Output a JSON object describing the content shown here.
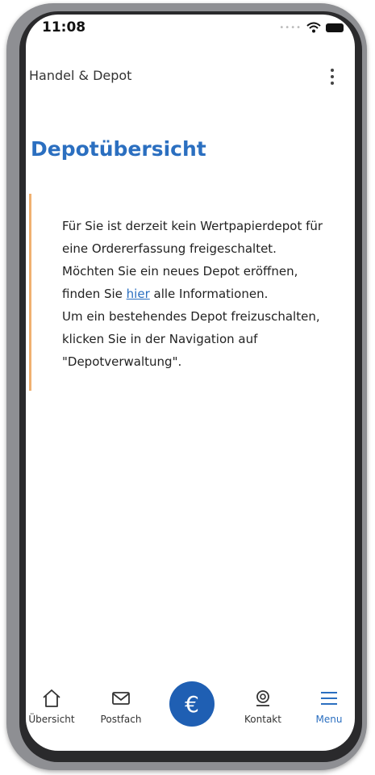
{
  "status_bar": {
    "time": "11:08"
  },
  "header": {
    "title": "Handel & Depot"
  },
  "page": {
    "title": "Depotübersicht"
  },
  "info": {
    "line1": "Für Sie ist derzeit kein Wertpapierdepot für eine Ordererfassung freigeschaltet. Möchten Sie ein neues Depot eröffnen, finden Sie ",
    "link": "hier",
    "line2": " alle Informationen.",
    "line3": "Um ein bestehendes Depot freizuschalten, klicken Sie in der Navigation auf \"Depotverwaltung\"."
  },
  "tabbar": {
    "items": [
      {
        "label": "Übersicht",
        "icon": "home-icon"
      },
      {
        "label": "Postfach",
        "icon": "mail-icon"
      },
      {
        "label": "€",
        "icon": "euro-icon"
      },
      {
        "label": "Kontakt",
        "icon": "contact-icon"
      },
      {
        "label": "Menu",
        "icon": "menu-icon"
      }
    ]
  },
  "colors": {
    "accent": "#2b6fc0",
    "fab": "#1f5fb3",
    "info_border": "#f0b070"
  }
}
